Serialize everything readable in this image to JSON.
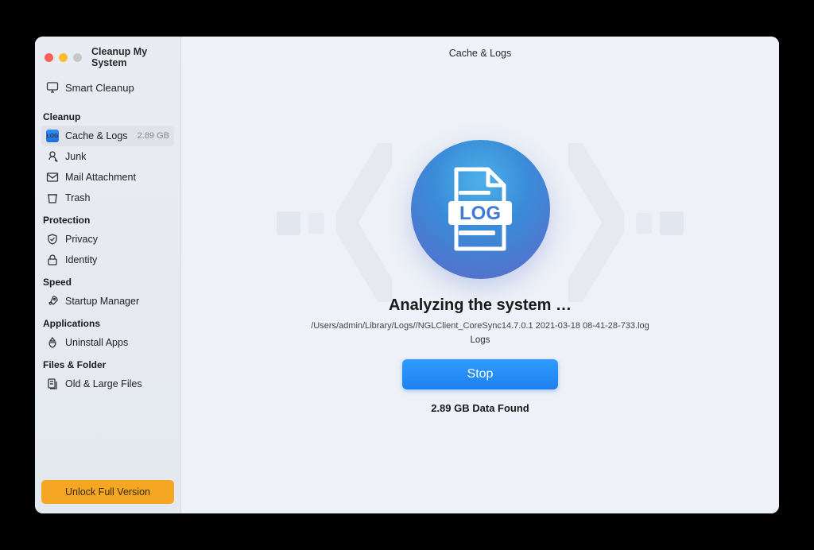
{
  "app_title": "Cleanup My System",
  "header_title": "Cache & Logs",
  "smart_cleanup_label": "Smart Cleanup",
  "sections": {
    "cleanup": {
      "header": "Cleanup",
      "items": [
        {
          "label": "Cache & Logs",
          "badge": "2.89 GB",
          "active": true
        },
        {
          "label": "Junk"
        },
        {
          "label": "Mail Attachment"
        },
        {
          "label": "Trash"
        }
      ]
    },
    "protection": {
      "header": "Protection",
      "items": [
        {
          "label": "Privacy"
        },
        {
          "label": "Identity"
        }
      ]
    },
    "speed": {
      "header": "Speed",
      "items": [
        {
          "label": "Startup Manager"
        }
      ]
    },
    "applications": {
      "header": "Applications",
      "items": [
        {
          "label": "Uninstall Apps"
        }
      ]
    },
    "files": {
      "header": "Files & Folder",
      "items": [
        {
          "label": "Old & Large Files"
        }
      ]
    }
  },
  "unlock_label": "Unlock Full Version",
  "status": {
    "title": "Analyzing the system …",
    "path": "/Users/admin/Library/Logs//NGLClient_CoreSync14.7.0.1 2021-03-18 08-41-28-733.log",
    "sub": "Logs",
    "stop_label": "Stop",
    "data_found": "2.89 GB Data Found"
  },
  "log_icon_text": "LOG",
  "log_badge_text": "LOG"
}
